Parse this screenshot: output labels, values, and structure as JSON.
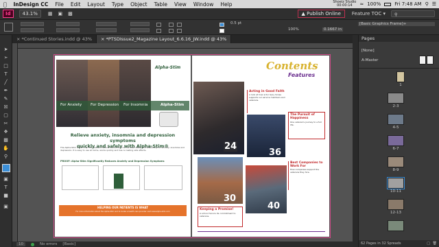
{
  "menubar": {
    "app_name": "InDesign CC",
    "items": [
      "File",
      "Edit",
      "Layout",
      "Type",
      "Object",
      "Table",
      "View",
      "Window",
      "Help"
    ],
    "status_app": "Shoeiz Studio",
    "status_time": "00:00:14",
    "battery": "100%",
    "clock": "Fri 7:48 AM"
  },
  "appbar": {
    "logo": "Id",
    "zoom": "43.1%",
    "publish_label": "Publish Online",
    "workspace_label": "Feature TOC"
  },
  "control": {
    "stroke_value": "0.5 pt",
    "percent_value": "100%",
    "measure_value": "0.1667 in",
    "style_select": "[Basic Graphics Frame]+"
  },
  "tabs": [
    {
      "label": "*Continued Stories.indd @ 43%",
      "active": false
    },
    {
      "label": "*PTSDIssue2_Magazine Layout_6.6.16_JW.indd @ 43%",
      "active": true
    }
  ],
  "left_page": {
    "brand_logo": "Alpha-Stim",
    "banner_items": [
      "For Anxiety",
      "For Depression",
      "For Insomnia"
    ],
    "banner_brand": "Alpha-Stim",
    "headline_line1": "Relieve anxiety, insomnia and depression symptoms",
    "headline_line2": "quickly and safely with Alpha-Stim®",
    "body_text": "The Alpha-Stim is the only FDA-cleared medical device that can be used safely and effectively for anxiety, insomnia and depression. It is easy to use at home, works quickly and has no lasting side effects.",
    "chart_section_title": "PROOF: Alpha-Stim Significantly Reduces Anxiety and Depression Symptoms",
    "cta_text": "HELPING OUR PATIENTS IS WHAT",
    "cta_subtext": "For more information about the Alpha-Stim and to locate a health care provider visit www.alpha-stim.com"
  },
  "right_page": {
    "contents_title": "Contents",
    "features_label": "Features",
    "page_numbers": [
      "24",
      "36",
      "30",
      "40"
    ],
    "story1_title": "Acting in Good Faith",
    "story1_text": "A look at how actor Gary Sinise supports our service members and veterans.",
    "story2_title": "The Pursuit of Happiness",
    "story2_text": "One veteran's journey to a full life.",
    "story3_title": "Keeping a Promise!",
    "story3_text": "A school honors its commitment to veterans.",
    "story4_title": "Best Companies to Work For",
    "story4_text": "How companies support the veterans they hire."
  },
  "statusbar": {
    "page": "10",
    "errors": "No errors",
    "style": "[Basic]"
  },
  "pages_panel": {
    "title": "Pages",
    "none_label": "[None]",
    "master_label": "A-Master",
    "thumb_labels": [
      "1",
      "2-3",
      "4-5",
      "6-7",
      "8-9",
      "10-11",
      "12-13"
    ],
    "footer_text": "62 Pages in 32 Spreads"
  },
  "colors": {
    "green_banner": "#2e5e3a",
    "contents_gold": "#d8b22e",
    "features_purple": "#6b2f8f",
    "story_red": "#c0282a",
    "cta_orange": "#e5732b"
  }
}
